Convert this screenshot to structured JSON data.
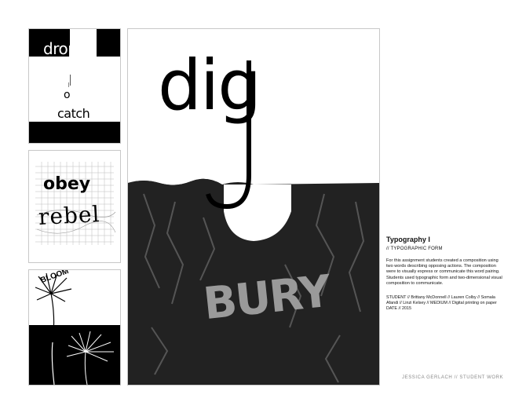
{
  "panels": {
    "drop_catch": {
      "word_top": "drop",
      "word_bottom": "catch",
      "letter": "o"
    },
    "obey_rebel": {
      "word_top": "obey",
      "word_bottom": "rebel"
    },
    "bloom": {
      "word": "BLOOM"
    },
    "dig_bury": {
      "word_top": "dig",
      "word_bottom": "BURY"
    }
  },
  "caption": {
    "title": "Typography I",
    "subtitle": "// TYPOGRAPHIC FORM",
    "description": "For this assignment students created a composition using two words describing opposing actions. The composition were to visually express or communicate this word pairing. Students used typographic form and two-dimensional visual composition to communicate.",
    "credits_line1": "STUDENT // Brittany McDonnell // Lauren Colby // Somala Afandi // Linzi Kelsey // MEDIUM // Digital printing on paper",
    "credits_line2": "DATE // 2015"
  },
  "footer": "JESSICA GERLACH // STUDENT WORK"
}
